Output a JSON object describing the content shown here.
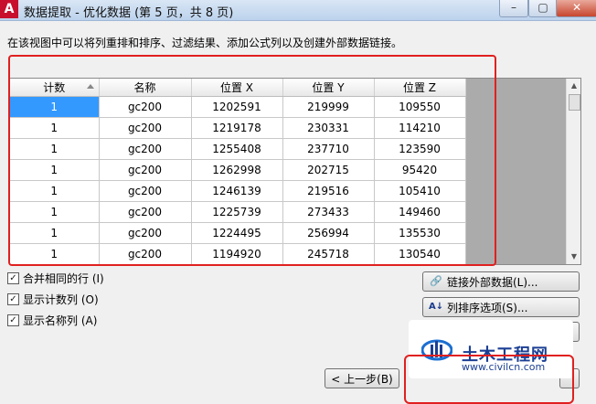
{
  "window": {
    "app_icon_text": "A",
    "title": "数据提取 - 优化数据 (第 5 页，共 8 页)",
    "min_glyph": "–",
    "max_glyph": "▢",
    "close_glyph": "✕"
  },
  "instructions": "在该视图中可以将列重排和排序、过滤结果、添加公式列以及创建外部数据链接。",
  "grid": {
    "columns": [
      "计数",
      "名称",
      "位置 X",
      "位置 Y",
      "位置 Z"
    ],
    "rows": [
      [
        "1",
        "gc200",
        "1202591",
        "219999",
        "109550"
      ],
      [
        "1",
        "gc200",
        "1219178",
        "230331",
        "114210"
      ],
      [
        "1",
        "gc200",
        "1255408",
        "237710",
        "123590"
      ],
      [
        "1",
        "gc200",
        "1262998",
        "202715",
        "95420"
      ],
      [
        "1",
        "gc200",
        "1246139",
        "219516",
        "105410"
      ],
      [
        "1",
        "gc200",
        "1225739",
        "273433",
        "149460"
      ],
      [
        "1",
        "gc200",
        "1224495",
        "256994",
        "135530"
      ],
      [
        "1",
        "gc200",
        "1194920",
        "245718",
        "130540"
      ]
    ],
    "selected_row": 0
  },
  "options": {
    "combine_rows": "合并相同的行 (I)",
    "show_count": "显示计数列 (O)",
    "show_name": "显示名称列 (A)"
  },
  "buttons": {
    "link_external": "链接外部数据(L)...",
    "sort_options": "列排序选项(S)...",
    "back": "< 上一步(B)"
  },
  "watermark": {
    "name": "土木工程网",
    "url": "www.civilcn.com"
  }
}
